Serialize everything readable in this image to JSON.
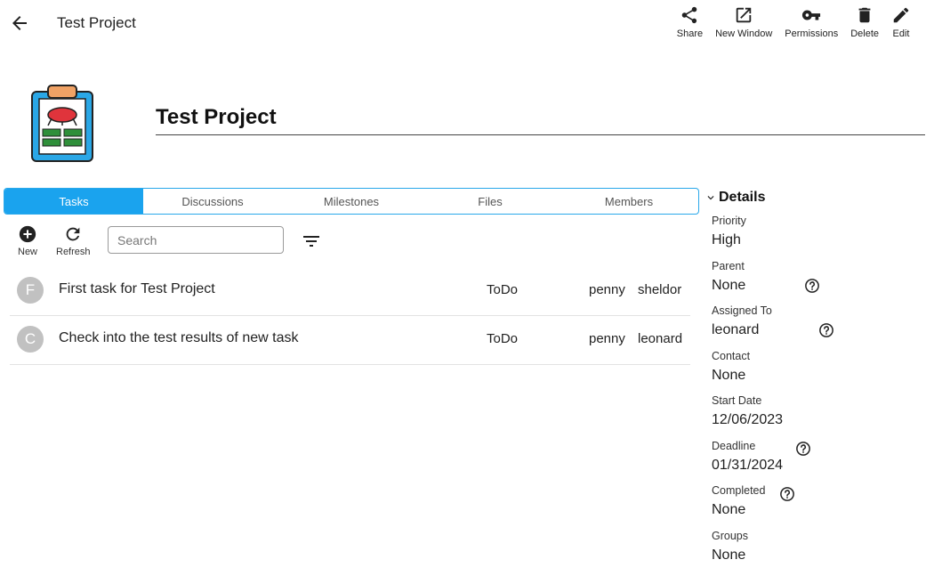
{
  "header": {
    "title": "Test Project",
    "actions": [
      {
        "label": "Share",
        "icon": "share-icon"
      },
      {
        "label": "New Window",
        "icon": "open-in-new-icon"
      },
      {
        "label": "Permissions",
        "icon": "key-icon"
      },
      {
        "label": "Delete",
        "icon": "trash-icon"
      },
      {
        "label": "Edit",
        "icon": "pencil-icon"
      }
    ]
  },
  "project": {
    "title": "Test Project",
    "logo_icon": "clipboard-icon"
  },
  "tabs": [
    {
      "label": "Tasks",
      "active": true
    },
    {
      "label": "Discussions",
      "active": false
    },
    {
      "label": "Milestones",
      "active": false
    },
    {
      "label": "Files",
      "active": false
    },
    {
      "label": "Members",
      "active": false
    }
  ],
  "toolbar": {
    "new_label": "New",
    "refresh_label": "Refresh",
    "search_placeholder": "Search"
  },
  "tasks": [
    {
      "initial": "F",
      "name": "First task for Test Project",
      "status": "ToDo",
      "assignee1": "penny",
      "assignee2": "sheldor"
    },
    {
      "initial": "C",
      "name": "Check into the test results of new task",
      "status": "ToDo",
      "assignee1": "penny",
      "assignee2": "leonard"
    }
  ],
  "details": {
    "heading": "Details",
    "priority_label": "Priority",
    "priority": "High",
    "parent_label": "Parent",
    "parent": "None",
    "assigned_label": "Assigned To",
    "assigned": "leonard",
    "contact_label": "Contact",
    "contact": "None",
    "start_label": "Start Date",
    "start": "12/06/2023",
    "deadline_label": "Deadline",
    "deadline": "01/31/2024",
    "completed_label": "Completed",
    "completed": "None",
    "groups_label": "Groups",
    "groups": "None"
  },
  "colors": {
    "accent": "#1aa3ee",
    "avatar": "#c1c1c1"
  }
}
